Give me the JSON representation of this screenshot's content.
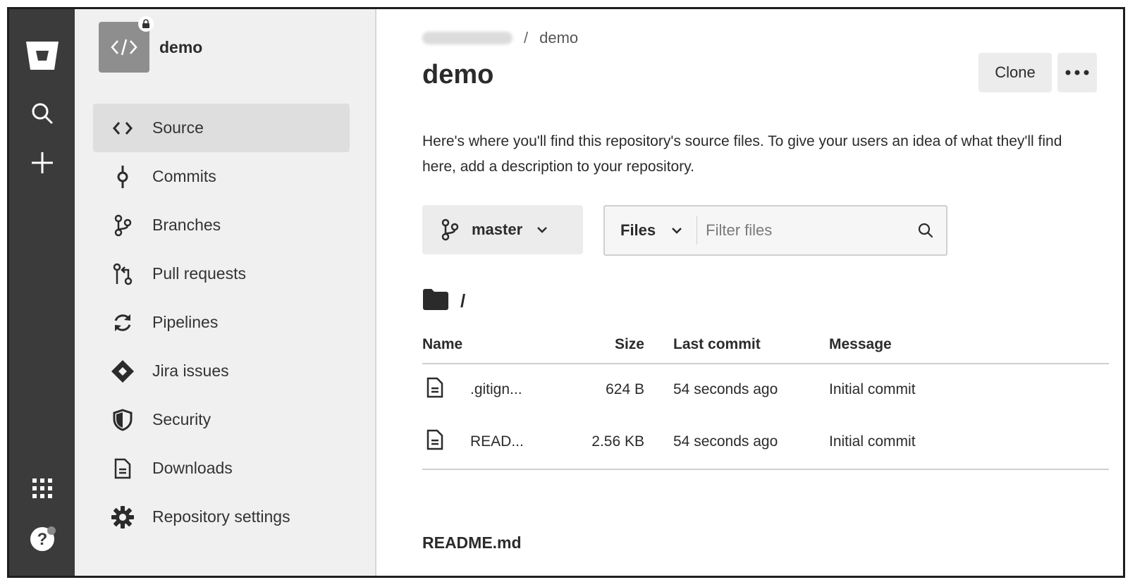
{
  "global_nav": {
    "icons": [
      "bitbucket-logo-icon",
      "search-icon",
      "plus-icon",
      "app-switcher-icon",
      "help-icon"
    ]
  },
  "sidebar": {
    "repo_name": "demo",
    "repo_avatar_icon": "code-icon",
    "items": [
      {
        "label": "Source",
        "icon": "code-icon",
        "active": true
      },
      {
        "label": "Commits",
        "icon": "commit-icon"
      },
      {
        "label": "Branches",
        "icon": "branch-icon"
      },
      {
        "label": "Pull requests",
        "icon": "pull-request-icon"
      },
      {
        "label": "Pipelines",
        "icon": "pipelines-icon"
      },
      {
        "label": "Jira issues",
        "icon": "jira-icon"
      },
      {
        "label": "Security",
        "icon": "shield-icon"
      },
      {
        "label": "Downloads",
        "icon": "download-file-icon"
      },
      {
        "label": "Repository settings",
        "icon": "gear-icon"
      }
    ]
  },
  "main": {
    "breadcrumb": {
      "separator": "/",
      "repo": "demo"
    },
    "title": "demo",
    "clone_label": "Clone",
    "description": "Here's where you'll find this repository's source files. To give your users an idea of what they'll find here, add a description to your repository.",
    "branch": "master",
    "filter": {
      "type": "Files",
      "placeholder": "Filter files"
    },
    "path": "/",
    "table": {
      "headers": {
        "name": "Name",
        "size": "Size",
        "last_commit": "Last commit",
        "message": "Message"
      },
      "rows": [
        {
          "name": ".gitign...",
          "size": "624 B",
          "last_commit": "54 seconds ago",
          "message": "Initial commit"
        },
        {
          "name": "READ...",
          "size": "2.56 KB",
          "last_commit": "54 seconds ago",
          "message": "Initial commit"
        }
      ]
    },
    "readme_title": "README.md"
  },
  "colors": {
    "global_nav_bg": "#3b3b3b",
    "sidebar_bg": "#f0f0f0",
    "active_item_bg": "#dedede",
    "button_bg": "#ececec"
  }
}
